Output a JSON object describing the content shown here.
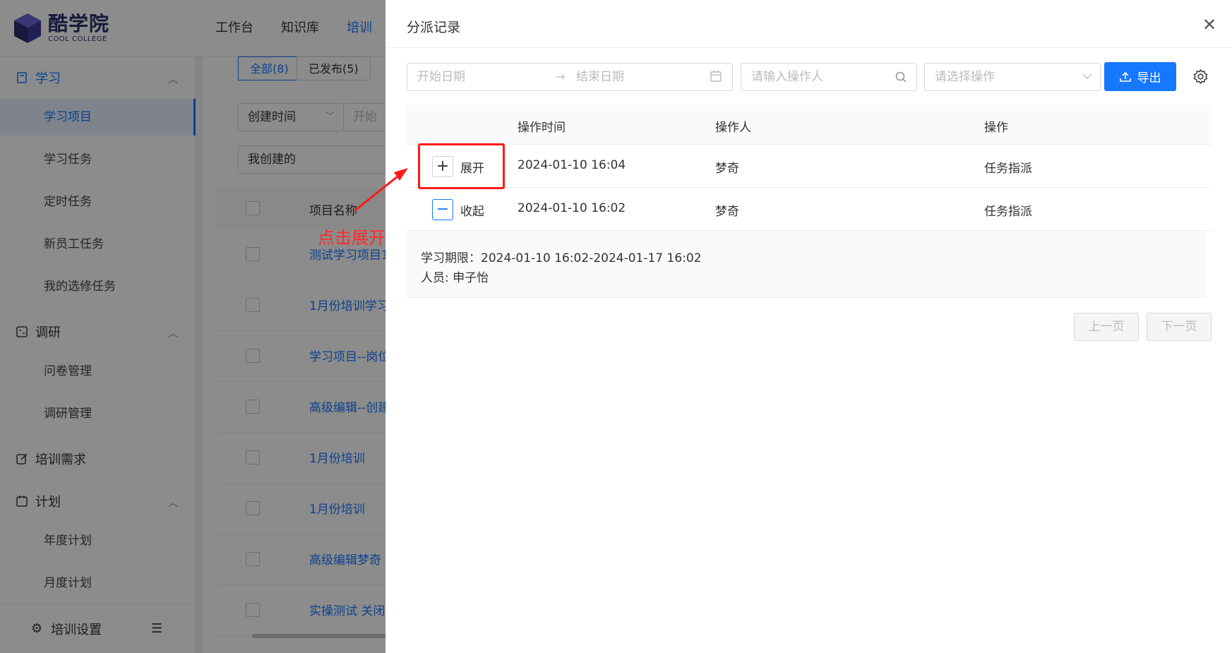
{
  "app": {
    "logo_cn": "酷学院",
    "logo_en": "COOL COLLEGE",
    "topnav": [
      "工作台",
      "知识库",
      "培训"
    ],
    "sidebar": {
      "groups": [
        {
          "label": "学习",
          "icon": "book-icon"
        },
        {
          "label": "调研",
          "icon": "calculator-icon"
        },
        {
          "label": "培训需求",
          "icon": "edit-icon"
        },
        {
          "label": "计划",
          "icon": "calendar-icon"
        }
      ],
      "items": [
        "学习项目",
        "学习任务",
        "定时任务",
        "新员工任务",
        "我的选修任务",
        "问卷管理",
        "调研管理",
        "年度计划",
        "月度计划"
      ],
      "footer": "培训设置"
    },
    "tabs": [
      "全部(8)",
      "已发布(5)"
    ],
    "filters": {
      "created_time": "创建时间",
      "start": "开始",
      "mine": "我创建的"
    },
    "table_header": "项目名称",
    "rows": [
      "测试学习项目1",
      "1月份培训学习",
      "学习项目--岗位",
      "高级编辑--创建",
      "1月份培训",
      "1月份培训",
      "高级编辑梦奇",
      "实操测试 关闭"
    ]
  },
  "drawer": {
    "title": "分派记录",
    "start_placeholder": "开始日期",
    "end_placeholder": "结束日期",
    "operator_placeholder": "请输入操作人",
    "action_placeholder": "请选择操作",
    "export_label": "导出",
    "columns": [
      "操作时间",
      "操作人",
      "操作"
    ],
    "records": [
      {
        "toggle": "展开",
        "time": "2024-01-10 16:04",
        "operator": "梦奇",
        "action": "任务指派"
      },
      {
        "toggle": "收起",
        "time": "2024-01-10 16:02",
        "operator": "梦奇",
        "action": "任务指派"
      }
    ],
    "expanded": {
      "period": "学习期限：2024-01-10 16:02-2024-01-17 16:02",
      "people": "人员: 申子怡"
    },
    "prev_label": "上一页",
    "next_label": "下一页"
  },
  "annotation": {
    "text": "点击展开",
    "color": "#ff1a1a"
  },
  "colors": {
    "primary": "#1677ff",
    "logo": "#2b2f6b"
  }
}
